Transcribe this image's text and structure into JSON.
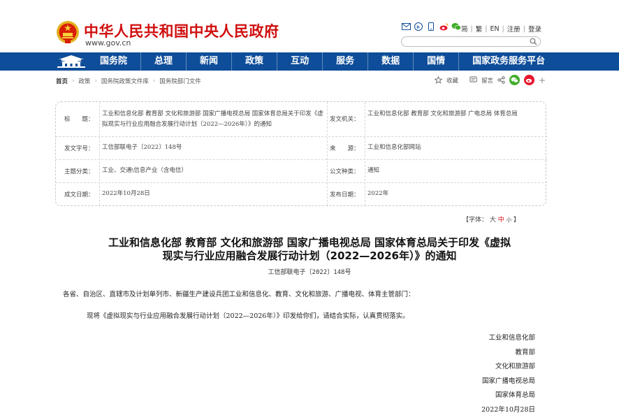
{
  "header": {
    "site_title": "中华人民共和国中央人民政府",
    "site_url": "www.gov.cn",
    "links": [
      "简",
      "繁",
      "EN",
      "注册",
      "登录"
    ],
    "search_placeholder": ""
  },
  "nav": {
    "items": [
      "国务院",
      "总理",
      "新闻",
      "政策",
      "互动",
      "服务",
      "数据",
      "国情",
      "国家政务服务平台"
    ]
  },
  "breadcrumb": [
    "首页",
    "政策",
    "国务院政策文件库",
    "国务院部门文件"
  ],
  "share": {
    "collect": "收藏",
    "comment": "留言"
  },
  "info": {
    "title_label": "标　　题：",
    "title_value": "工业和信息化部 教育部 文化和旅游部 国家广播电视总局 国家体育总局关于印发《虚拟现实与行业应用融合发展行动计划（2022—2026年）》的通知",
    "issuer_label": "发文机关：",
    "issuer_value": "工业和信息化部 教育部 文化和旅游部 广电总局 体育总局",
    "docnum_label": "发文字号：",
    "docnum_value": "工信部联电子〔2022〕148号",
    "source_label": "来　　源：",
    "source_value": "工业和信息化部网站",
    "subject_label": "主题分类：",
    "subject_value": "工业、交通\\信息产业（含电信）",
    "type_label": "公文种类：",
    "type_value": "通知",
    "written_label": "成文日期：",
    "written_value": "2022年10月28日",
    "published_label": "发布日期：",
    "published_value": "2022年"
  },
  "fontsize": {
    "prefix": "【字体：",
    "large": "大",
    "medium": "中",
    "small": "小",
    "suffix": "】"
  },
  "doc": {
    "title_line1": "工业和信息化部 教育部 文化和旅游部 国家广播电视总局 国家体育总局关于印发《虚拟",
    "title_line2": "现实与行业应用融合发展行动计划（2022—2026年）》的通知",
    "number": "工信部联电子〔2022〕148号",
    "addressee": "各省、自治区、直辖市及计划单列市、新疆生产建设兵团工业和信息化、教育、文化和旅游、广播电视、体育主管部门：",
    "body": "现将《虚拟现实与行业应用融合发展行动计划（2022—2026年）》印发给你们，请结合实际，认真贯彻落实。",
    "signers": [
      "工业和信息化部",
      "教育部",
      "文化和旅游部",
      "国家广播电视总局",
      "国家体育总局",
      "2022年10月28日"
    ]
  },
  "colors": {
    "brand_red": "#d00e0e",
    "nav_blue": "#0e4d99"
  }
}
